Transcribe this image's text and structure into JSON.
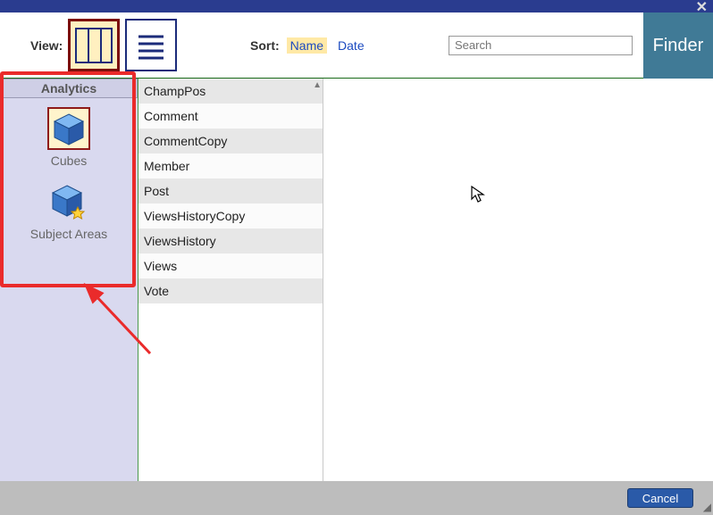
{
  "header": {
    "close_glyph": "✕"
  },
  "toolbar": {
    "view_label": "View:",
    "sort_label": "Sort:",
    "sort_options": {
      "name": "Name",
      "date": "Date"
    },
    "search_placeholder": "Search",
    "finder_label": "Finder"
  },
  "sidebar": {
    "heading": "Analytics",
    "items": [
      {
        "label": "Cubes",
        "selected": true
      },
      {
        "label": "Subject Areas",
        "selected": false
      }
    ]
  },
  "list": {
    "rows": [
      "ChampPos",
      "Comment",
      "CommentCopy",
      "Member",
      "Post",
      "ViewsHistoryCopy",
      "ViewsHistory",
      "Views",
      "Vote"
    ]
  },
  "footer": {
    "cancel_label": "Cancel"
  }
}
